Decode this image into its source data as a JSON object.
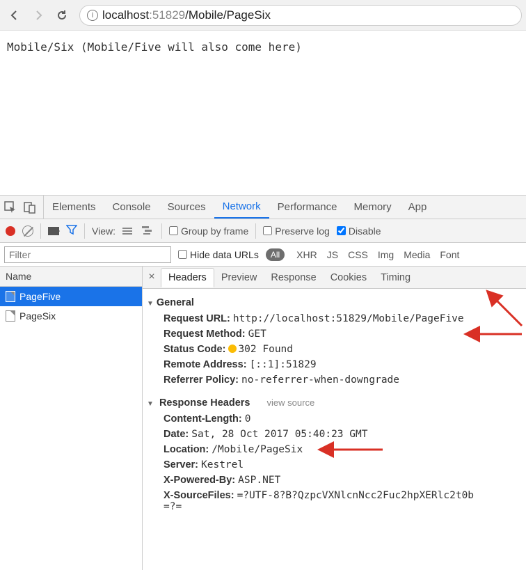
{
  "address": {
    "host_dim": "localhost",
    "port": ":51829",
    "path": "/Mobile/PageSix"
  },
  "page_text": "Mobile/Six (Mobile/Five will also come here)",
  "devtools": {
    "tabs": [
      "Elements",
      "Console",
      "Sources",
      "Network",
      "Performance",
      "Memory",
      "App"
    ],
    "active_tab": "Network",
    "toolbar": {
      "view_label": "View:",
      "group_label": "Group by frame",
      "preserve_label": "Preserve log",
      "disable_label": "Disable"
    },
    "filter": {
      "placeholder": "Filter",
      "hide_urls": "Hide data URLs",
      "all": "All",
      "types": [
        "XHR",
        "JS",
        "CSS",
        "Img",
        "Media",
        "Font"
      ]
    },
    "list": {
      "header": "Name",
      "rows": [
        "PageFive",
        "PageSix"
      ],
      "selected": 0
    },
    "subtabs": [
      "Headers",
      "Preview",
      "Response",
      "Cookies",
      "Timing"
    ],
    "active_subtab": "Headers",
    "headers": {
      "general_title": "General",
      "general": [
        {
          "k": "Request URL:",
          "v": "http://localhost:51829/Mobile/PageFive"
        },
        {
          "k": "Request Method:",
          "v": "GET"
        },
        {
          "k": "Status Code:",
          "v": "302 Found",
          "status": true
        },
        {
          "k": "Remote Address:",
          "v": "[::1]:51829"
        },
        {
          "k": "Referrer Policy:",
          "v": "no-referrer-when-downgrade"
        }
      ],
      "response_title": "Response Headers",
      "view_source": "view source",
      "response": [
        {
          "k": "Content-Length:",
          "v": "0"
        },
        {
          "k": "Date:",
          "v": "Sat, 28 Oct 2017 05:40:23 GMT"
        },
        {
          "k": "Location:",
          "v": "/Mobile/PageSix"
        },
        {
          "k": "Server:",
          "v": "Kestrel"
        },
        {
          "k": "X-Powered-By:",
          "v": "ASP.NET"
        },
        {
          "k": "X-SourceFiles:",
          "v": "=?UTF-8?B?QzpcVXNlcnNcc2Fuc2hpXERlc2t0b\n=?="
        }
      ]
    }
  }
}
